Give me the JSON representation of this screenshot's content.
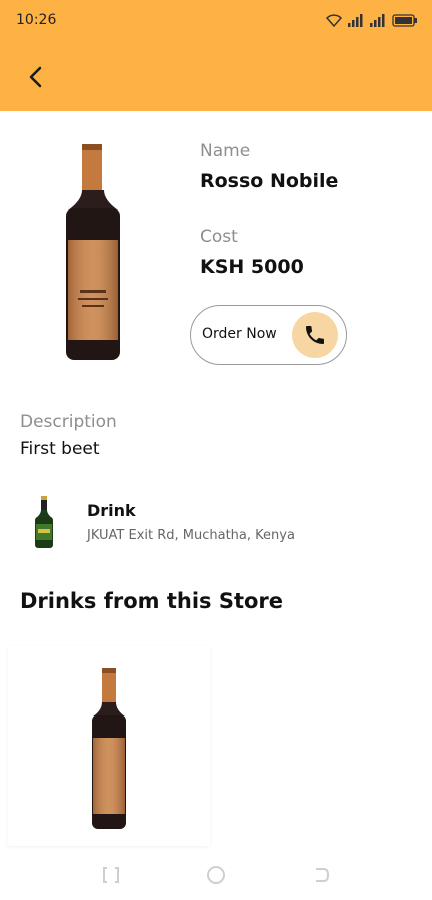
{
  "status_bar": {
    "time": "10:26"
  },
  "header": {
    "back_label": "Back"
  },
  "product": {
    "name_label": "Name",
    "name": "Rosso Nobile",
    "cost_label": "Cost",
    "cost": "KSH 5000",
    "order_button_label": "Order Now",
    "description_label": "Description",
    "description": "First beet"
  },
  "store": {
    "title": "Drink",
    "address": "JKUAT Exit Rd, Muchatha, Kenya"
  },
  "section": {
    "title": "Drinks from this Store"
  },
  "colors": {
    "accent": "#FFB244",
    "phone_bg": "#F7D6A4"
  },
  "icons": [
    "back-arrow-icon",
    "phone-icon",
    "wifi-icon",
    "signal-icon",
    "battery-icon"
  ]
}
